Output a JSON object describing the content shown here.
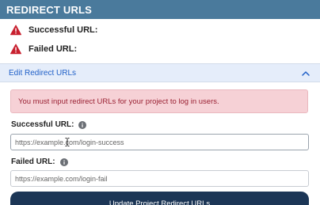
{
  "header": {
    "title": "REDIRECT URLS"
  },
  "status": {
    "successful_label": "Successful URL:",
    "failed_label": "Failed URL:"
  },
  "edit_section": {
    "title": "Edit Redirect URLs"
  },
  "alert": {
    "message": "You must input redirect URLs for your project to log in users."
  },
  "form": {
    "successful": {
      "label": "Successful URL:",
      "placeholder": "https://example.com/login-success",
      "value": ""
    },
    "failed": {
      "label": "Failed URL:",
      "placeholder": "https://example.com/login-fail",
      "value": ""
    },
    "submit_label": "Update Project Redirect URLs"
  },
  "colors": {
    "header_bg": "#4a7a9c",
    "warning_red": "#c8202f",
    "edit_bar_bg": "#e5edfa",
    "link_blue": "#1f5fc7",
    "alert_bg": "#f6d1d6",
    "alert_text": "#9a2133",
    "button_bg": "#1c3656"
  },
  "icons": [
    "warning-icon",
    "chevron-up-icon",
    "info-icon",
    "text-cursor-icon"
  ]
}
